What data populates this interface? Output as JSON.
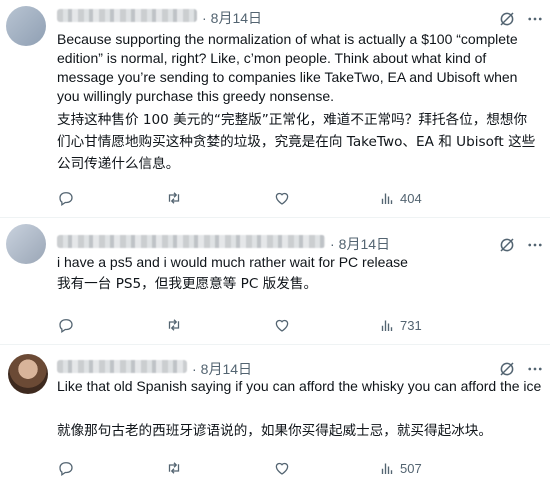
{
  "posts": [
    {
      "date": "8月14日",
      "text_en": "Because supporting the normalization of what is actually a $100 “complete edition” is normal, right? Like, c’mon people. Think about what kind of message you’re sending to companies like TakeTwo, EA and Ubisoft when you willingly purchase this greedy nonsense.",
      "text_zh": "支持这种售价 100 美元的“完整版”正常化，难道不正常吗？拜托各位，想想你们心甘情愿地购买这种贪婪的垃圾，究竟是在向 TakeTwo、EA 和 Ubisoft 这些公司传递什么信息。",
      "views": "404"
    },
    {
      "date": "8月14日",
      "text_en": "i have a ps5 and i would much rather wait for PC release",
      "text_zh": "我有一台 PS5，但我更愿意等 PC 版发售。",
      "views": "731"
    },
    {
      "date": "8月14日",
      "text_en": "Like that old Spanish saying if you can afford the whisky you can afford the ice",
      "text_zh": "就像那句古老的西班牙谚语说的，如果你买得起威士忌，就买得起冰块。",
      "views": "507"
    }
  ],
  "icons": {
    "reply": "reply-icon",
    "repost": "repost-icon",
    "like": "like-icon",
    "views": "views-icon",
    "grok": "grok-icon",
    "more": "more-icon"
  },
  "colors": {
    "text": "#0f1419",
    "muted": "#536471",
    "divider": "#eff3f4"
  }
}
